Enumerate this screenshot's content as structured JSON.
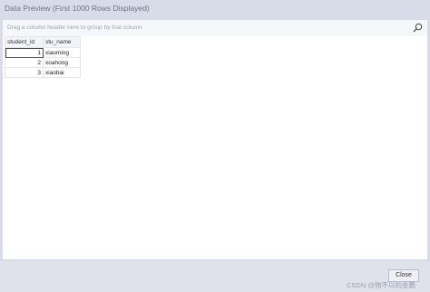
{
  "window": {
    "title": "Data Preview (First 1000 Rows Displayed)"
  },
  "group_panel": {
    "hint": "Drag a column header here to group by that column",
    "search_icon": "search-icon"
  },
  "grid": {
    "columns": [
      "student_id",
      "stu_name"
    ],
    "rows": [
      {
        "student_id": "1",
        "stu_name": "xiaoming"
      },
      {
        "student_id": "2",
        "stu_name": "xoahong"
      },
      {
        "student_id": "3",
        "stu_name": "xiaobai"
      }
    ]
  },
  "footer": {
    "close_label": "Close"
  },
  "watermark": "CSDN @物不以的金鹏"
}
